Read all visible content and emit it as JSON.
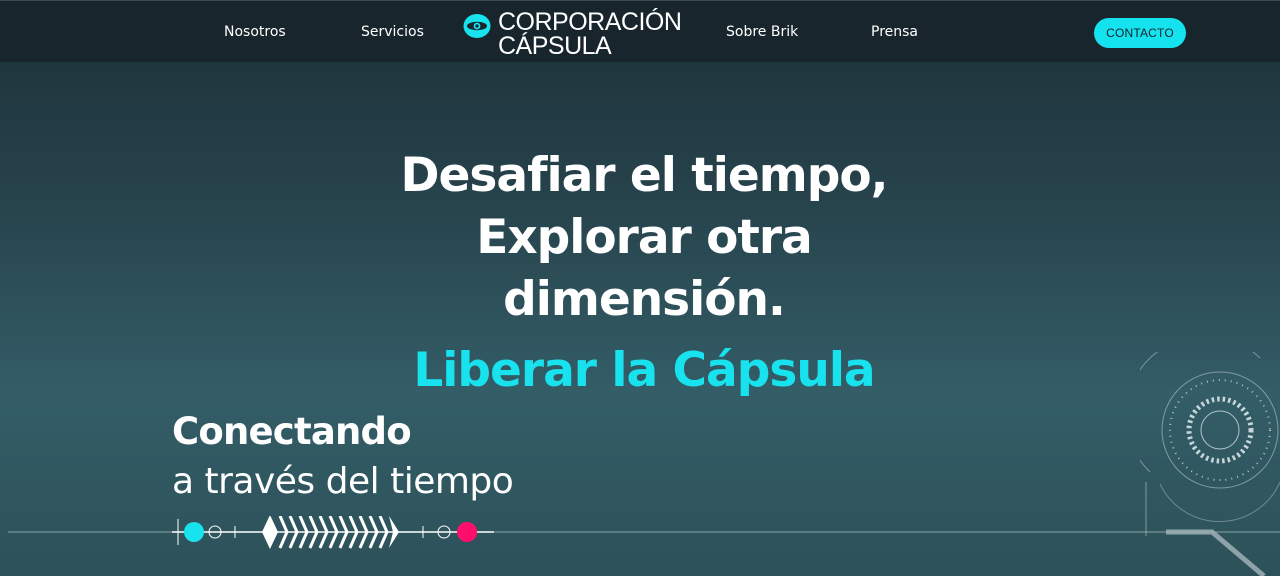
{
  "nav": {
    "items": [
      {
        "label": "Nosotros"
      },
      {
        "label": "Servicios"
      },
      {
        "label": "Sobre Brik"
      },
      {
        "label": "Prensa"
      }
    ],
    "logo": {
      "line1": "CORPORACIÓN",
      "line2": "CÁPSULA",
      "icon": "eye-icon"
    },
    "contact_label": "CONTACTO"
  },
  "hero": {
    "lines": [
      "Desafiar el tiempo,",
      "Explorar otra",
      "dimensión."
    ],
    "cta": "Liberar la Cápsula"
  },
  "section": {
    "title": "Conectando",
    "subtitle": "a través del tiempo"
  },
  "colors": {
    "accent": "#19e2ef",
    "magenta": "#ff0f6b",
    "nav_bg": "#18252d",
    "bg": "#2f5760"
  }
}
